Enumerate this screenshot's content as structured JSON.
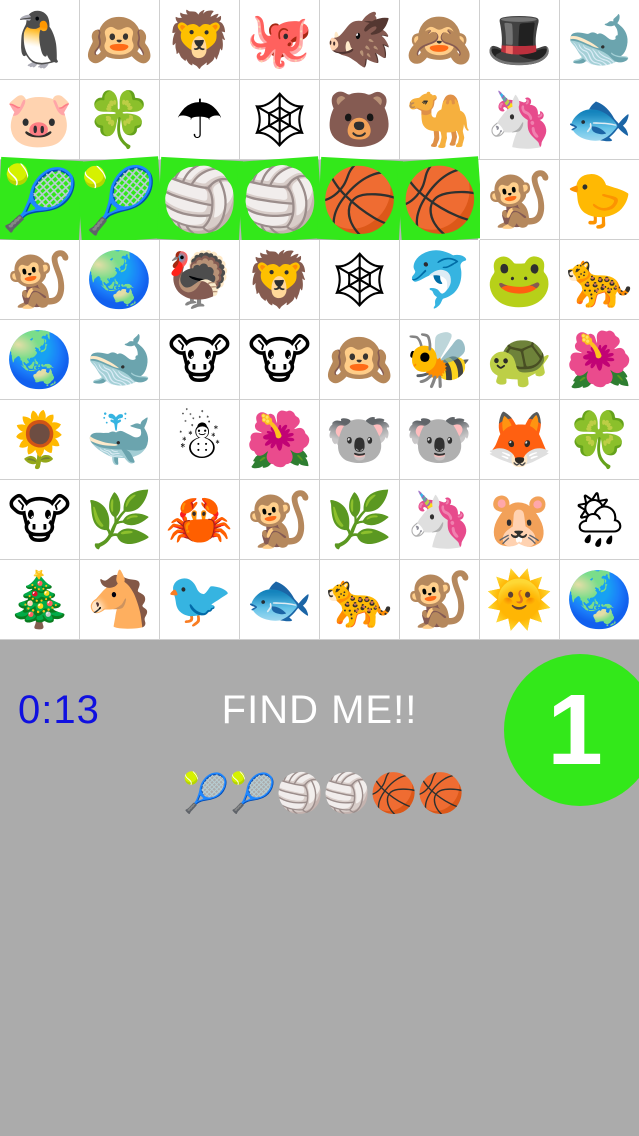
{
  "board": {
    "rows": [
      {
        "cells": [
          {
            "icon": "penguin",
            "glyph": "🐧"
          },
          {
            "icon": "hear-no-evil-monkey",
            "glyph": "🙉"
          },
          {
            "icon": "lion",
            "glyph": "🦁"
          },
          {
            "icon": "octopus",
            "glyph": "🐙"
          },
          {
            "icon": "boar",
            "glyph": "🐗"
          },
          {
            "icon": "see-no-evil-monkey",
            "glyph": "🙈"
          },
          {
            "icon": "top-hat",
            "glyph": "🎩"
          },
          {
            "icon": "whale",
            "glyph": "🐋"
          }
        ]
      },
      {
        "cells": [
          {
            "icon": "pig",
            "glyph": "🐷"
          },
          {
            "icon": "four-leaf-clover",
            "glyph": "🍀"
          },
          {
            "icon": "umbrella",
            "glyph": "☂"
          },
          {
            "icon": "spider-web",
            "glyph": "🕸"
          },
          {
            "icon": "bear",
            "glyph": "🐻"
          },
          {
            "icon": "camel",
            "glyph": "🐪"
          },
          {
            "icon": "unicorn",
            "glyph": "🦄"
          },
          {
            "icon": "fish",
            "glyph": "🐟"
          }
        ]
      },
      {
        "cells": [
          {
            "icon": "tennis-ball",
            "glyph": "🎾"
          },
          {
            "icon": "tennis-ball",
            "glyph": "🎾"
          },
          {
            "icon": "volleyball",
            "glyph": "🏐"
          },
          {
            "icon": "volleyball",
            "glyph": "🏐"
          },
          {
            "icon": "basketball",
            "glyph": "🏀"
          },
          {
            "icon": "basketball",
            "glyph": "🏀"
          },
          {
            "icon": "monkey",
            "glyph": "🐒"
          },
          {
            "icon": "chick",
            "glyph": "🐤"
          }
        ]
      },
      {
        "cells": [
          {
            "icon": "monkey",
            "glyph": "🐒"
          },
          {
            "icon": "globe",
            "glyph": "🌏"
          },
          {
            "icon": "turkey",
            "glyph": "🦃"
          },
          {
            "icon": "lion",
            "glyph": "🦁"
          },
          {
            "icon": "spider-web",
            "glyph": "🕸"
          },
          {
            "icon": "dolphin",
            "glyph": "🐬"
          },
          {
            "icon": "frog",
            "glyph": "🐸"
          },
          {
            "icon": "leopard",
            "glyph": "🐆"
          }
        ]
      },
      {
        "cells": [
          {
            "icon": "globe",
            "glyph": "🌏"
          },
          {
            "icon": "whale",
            "glyph": "🐋"
          },
          {
            "icon": "cow",
            "glyph": "🐮"
          },
          {
            "icon": "cow",
            "glyph": "🐮"
          },
          {
            "icon": "hear-no-evil-monkey",
            "glyph": "🙉"
          },
          {
            "icon": "bee",
            "glyph": "🐝"
          },
          {
            "icon": "turtle",
            "glyph": "🐢"
          },
          {
            "icon": "hibiscus",
            "glyph": "🌺"
          }
        ]
      },
      {
        "cells": [
          {
            "icon": "sunflower",
            "glyph": "🌻"
          },
          {
            "icon": "spouting-whale",
            "glyph": "🐳"
          },
          {
            "icon": "snowman",
            "glyph": "☃"
          },
          {
            "icon": "hibiscus",
            "glyph": "🌺"
          },
          {
            "icon": "koala",
            "glyph": "🐨"
          },
          {
            "icon": "koala",
            "glyph": "🐨"
          },
          {
            "icon": "fox",
            "glyph": "🦊"
          },
          {
            "icon": "four-leaf-clover",
            "glyph": "🍀"
          }
        ]
      },
      {
        "cells": [
          {
            "icon": "cow",
            "glyph": "🐮"
          },
          {
            "icon": "herb",
            "glyph": "🌿"
          },
          {
            "icon": "crab",
            "glyph": "🦀"
          },
          {
            "icon": "monkey",
            "glyph": "🐒"
          },
          {
            "icon": "herb",
            "glyph": "🌿"
          },
          {
            "icon": "unicorn",
            "glyph": "🦄"
          },
          {
            "icon": "hamster",
            "glyph": "🐹"
          },
          {
            "icon": "sun-behind-rain-cloud",
            "glyph": "🌦"
          }
        ]
      },
      {
        "cells": [
          {
            "icon": "christmas-tree",
            "glyph": "🎄"
          },
          {
            "icon": "horse",
            "glyph": "🐴"
          },
          {
            "icon": "bird",
            "glyph": "🐦"
          },
          {
            "icon": "fish",
            "glyph": "🐟"
          },
          {
            "icon": "leopard",
            "glyph": "🐆"
          },
          {
            "icon": "monkey",
            "glyph": "🐒"
          },
          {
            "icon": "sun-with-face",
            "glyph": "🌞"
          },
          {
            "icon": "globe",
            "glyph": "🌏"
          }
        ]
      }
    ],
    "found_row_index": 2,
    "found_count": 6,
    "highlight_color": "#33e81a"
  },
  "hud": {
    "timer": "0:13",
    "prompt": "FIND ME!!",
    "level": "1",
    "target": [
      {
        "icon": "tennis-ball",
        "glyph": "🎾"
      },
      {
        "icon": "tennis-ball",
        "glyph": "🎾"
      },
      {
        "icon": "volleyball",
        "glyph": "🏐"
      },
      {
        "icon": "volleyball",
        "glyph": "🏐"
      },
      {
        "icon": "basketball",
        "glyph": "🏀"
      },
      {
        "icon": "basketball",
        "glyph": "🏀"
      }
    ],
    "timer_color": "#1010e0",
    "badge_color": "#33e81a"
  }
}
